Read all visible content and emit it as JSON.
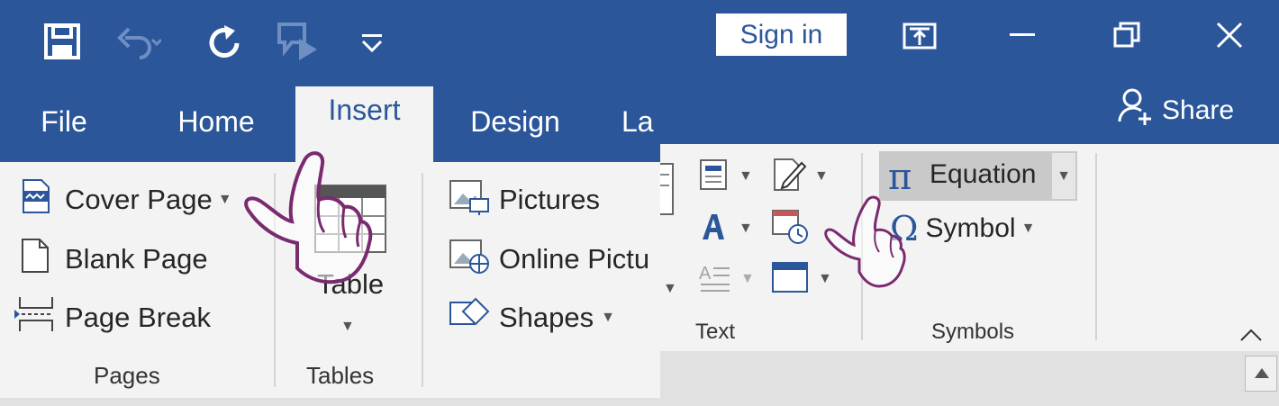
{
  "titlebar": {
    "signin_label": "Sign in",
    "share_label": "Share",
    "qat_icons": [
      "save-icon",
      "undo-icon",
      "redo-icon",
      "touch-mode-icon",
      "customize-icon"
    ],
    "window_icons": [
      "ribbon-display-icon",
      "minimize-icon",
      "restore-icon",
      "close-icon"
    ]
  },
  "tabs": [
    {
      "label": "File"
    },
    {
      "label": "Home"
    },
    {
      "label": "Insert",
      "active": true
    },
    {
      "label": "Design"
    },
    {
      "label": "La"
    }
  ],
  "ribbon": {
    "pages": {
      "label": "Pages",
      "items": [
        "Cover Page",
        "Blank Page",
        "Page Break"
      ]
    },
    "tables": {
      "label": "Tables",
      "table_label": "Table"
    },
    "illustrations": {
      "items": [
        "Pictures",
        "Online Pictu",
        "Shapes"
      ]
    },
    "text": {
      "label": "Text"
    },
    "symbols": {
      "label": "Symbols",
      "equation_label": "Equation",
      "symbol_label": "Symbol"
    }
  },
  "colors": {
    "accent": "#2b579a",
    "ribbon_bg": "#f3f3f3",
    "hand_stroke": "#7a2a6e"
  }
}
